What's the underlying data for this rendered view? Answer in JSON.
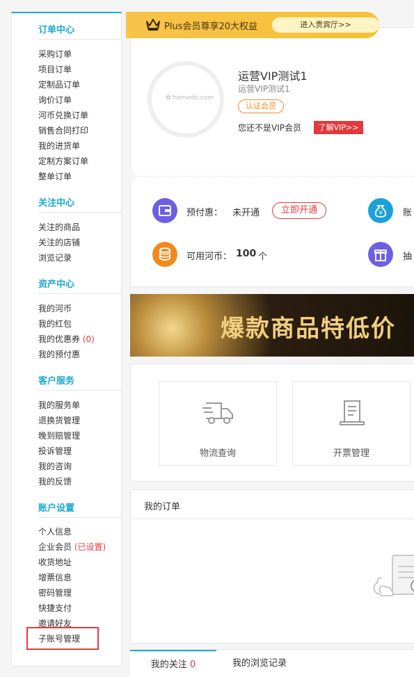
{
  "sidebar": {
    "sections": [
      {
        "title": "订单中心",
        "items": [
          {
            "label": "采购订单"
          },
          {
            "label": "项目订单"
          },
          {
            "label": "定制品订单"
          },
          {
            "label": "询价订单"
          },
          {
            "label": "河币兑换订单"
          },
          {
            "label": "销售合同打印"
          },
          {
            "label": "我的进货单"
          },
          {
            "label": "定制方案订单"
          },
          {
            "label": "整单订单"
          }
        ]
      },
      {
        "title": "关注中心",
        "items": [
          {
            "label": "关注的商品"
          },
          {
            "label": "关注的店铺"
          },
          {
            "label": "浏览记录"
          }
        ]
      },
      {
        "title": "资产中心",
        "items": [
          {
            "label": "我的河币"
          },
          {
            "label": "我的红包"
          },
          {
            "label": "我的优惠券",
            "extra": "(0)"
          },
          {
            "label": "我的预付惠"
          }
        ]
      },
      {
        "title": "客户服务",
        "items": [
          {
            "label": "我的服务单"
          },
          {
            "label": "退换货管理"
          },
          {
            "label": "晚到赔管理"
          },
          {
            "label": "投诉管理"
          },
          {
            "label": "我的咨询"
          },
          {
            "label": "我的反馈"
          }
        ]
      },
      {
        "title": "账户设置",
        "items": [
          {
            "label": "个人信息"
          },
          {
            "label": "企业会员",
            "extra": "(已设置)"
          },
          {
            "label": "收货地址"
          },
          {
            "label": "增票信息"
          },
          {
            "label": "密码管理"
          },
          {
            "label": "快捷支付"
          },
          {
            "label": "邀请好友"
          },
          {
            "label": "子账号管理"
          }
        ]
      }
    ]
  },
  "plus_bar": {
    "text": "Plus会员尊享20大权益",
    "button": "进入贵宾厅>>"
  },
  "profile": {
    "avatar_logo": "✿ homedo.com",
    "name": "运营VIP测试1",
    "sub_name": "运营VIP测试1",
    "badge": "认证会员",
    "not_vip_text": "您还不是VIP会员",
    "vip_button": "了解VIP>>"
  },
  "stats": {
    "prepay_label": "预付惠：",
    "prepay_value": "未开通",
    "open_button": "立即开通",
    "coins_label": "可用河币：",
    "coins_value": "100",
    "coins_unit": "个",
    "right1_label": "账",
    "right2_label": "抽"
  },
  "promo": {
    "text": "爆款商品特低价"
  },
  "tools": [
    {
      "label": "物流查询"
    },
    {
      "label": "开票管理"
    }
  ],
  "orders": {
    "title": "我的订单"
  },
  "tabs": {
    "follow_label": "我的关注",
    "follow_count": "0",
    "history_label": "我的浏览记录"
  },
  "colors": {
    "accent": "#19a9d0",
    "red": "#e4393c",
    "orange": "#f08c2c",
    "plus": "#f6c036"
  }
}
